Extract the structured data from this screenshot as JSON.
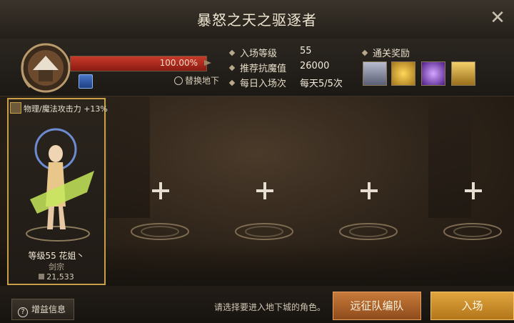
{
  "window": {
    "title": "暴怒之天之驱逐者"
  },
  "boss": {
    "hp_text": "100.00%",
    "hp_fraction": 1.0,
    "swap_label": "替换地下"
  },
  "stats": [
    {
      "label": "入场等级",
      "value": "55"
    },
    {
      "label": "推荐抗魔值",
      "value": "26000"
    },
    {
      "label": "每日入场次",
      "value": "每天5/5次"
    }
  ],
  "rewards": {
    "label": "通关奖励",
    "items": [
      {
        "icon": "armor-icon",
        "color": "#8a8ea6"
      },
      {
        "icon": "gold-coins-icon",
        "color": "#d4a22a"
      },
      {
        "icon": "purple-orb-icon",
        "color": "#7a3fc6"
      },
      {
        "icon": "gold-scroll-icon",
        "color": "#caa43a"
      }
    ]
  },
  "character": {
    "buff_text": "物理/魔法攻击力 +13%",
    "level_text": "等级55 花姐丶",
    "class_text": "剑宗",
    "power_text": "21,533"
  },
  "slots": [
    "empty",
    "empty",
    "empty",
    "empty"
  ],
  "footer": {
    "buff_button": "增益信息",
    "hint": "请选择要进入地下城的角色。",
    "party_button": "远征队编队",
    "enter_button": "入场"
  }
}
